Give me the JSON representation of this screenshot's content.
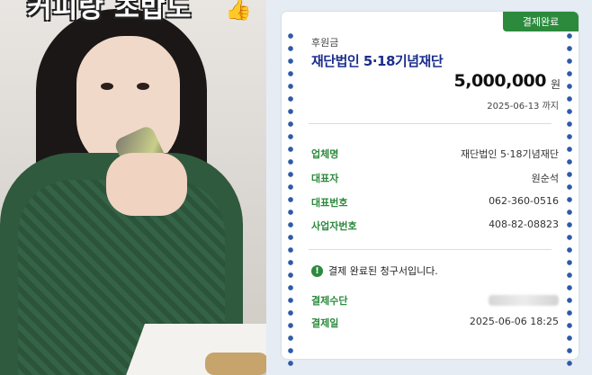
{
  "photo": {
    "caption": "커피랑 초밥도",
    "caption_emoji": "👍"
  },
  "receipt": {
    "status_badge": "결제완료",
    "label_small": "후원금",
    "organization": "재단법인 5·18기념재단",
    "amount": "5,000,000",
    "amount_unit": "원",
    "deadline": "2025-06-13 까지",
    "details": [
      {
        "key": "업체명",
        "value": "재단법인 5·18기념재단"
      },
      {
        "key": "대표자",
        "value": "원순석"
      },
      {
        "key": "대표번호",
        "value": "062-360-0516"
      },
      {
        "key": "사업자번호",
        "value": "408-82-08823"
      }
    ],
    "notice": "결제 완료된 청구서입니다.",
    "notice_icon": "!",
    "payment": [
      {
        "key": "결제수단",
        "value": ""
      },
      {
        "key": "결제일",
        "value": "2025-06-06 18:25"
      }
    ],
    "colors": {
      "accent_green": "#2c8a3d",
      "title_blue": "#1b2e8a",
      "dots_blue": "#2e5aa8"
    }
  }
}
